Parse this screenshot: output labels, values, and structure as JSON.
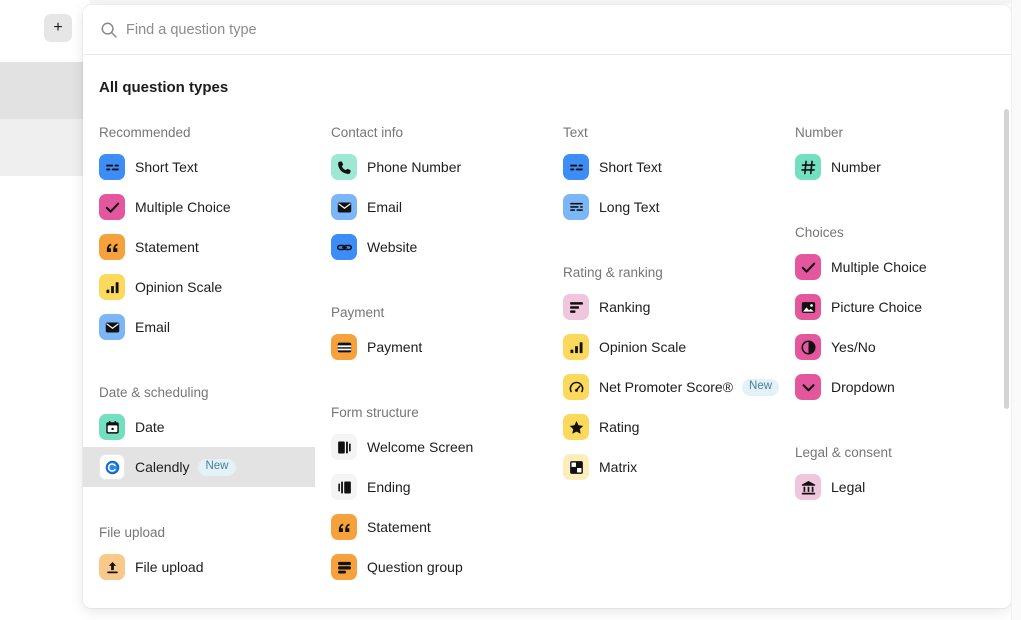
{
  "backdrop": {
    "add_button_label": "+"
  },
  "search": {
    "placeholder": "Find a question type",
    "value": "",
    "icon": "search-icon"
  },
  "panel": {
    "heading": "All question types"
  },
  "colors": {
    "blue": "#3c8df5",
    "blue_light": "#7bb6f7",
    "pink": "#e4579f",
    "pink_light": "#efc6dc",
    "orange": "#f6a23c",
    "yellow": "#fbd95c",
    "yellow_light": "#fbeeba",
    "teal": "#72e0c0",
    "white_tile": "#f4f4f4",
    "selected_row": "#e3e3e3",
    "badge_bg": "#e3f2f7",
    "badge_text": "#4a7f96"
  },
  "columns": [
    {
      "name": "column-1",
      "groups": [
        {
          "title": "Recommended",
          "items": [
            {
              "label": "Short Text",
              "icon": "short-text-icon",
              "tile": "blue"
            },
            {
              "label": "Multiple Choice",
              "icon": "check-icon",
              "tile": "pink"
            },
            {
              "label": "Statement",
              "icon": "quote-icon",
              "tile": "orange"
            },
            {
              "label": "Opinion Scale",
              "icon": "bar-chart-icon",
              "tile": "yellow"
            },
            {
              "label": "Email",
              "icon": "envelope-icon",
              "tile": "blue_light"
            }
          ]
        },
        {
          "title": "Date & scheduling",
          "spaced": true,
          "items": [
            {
              "label": "Date",
              "icon": "calendar-icon",
              "tile": "teal"
            },
            {
              "label": "Calendly",
              "icon": "calendly-icon",
              "tile": "white",
              "badge": "New",
              "selected": true
            }
          ]
        },
        {
          "title": "File upload",
          "spaced": true,
          "items": [
            {
              "label": "File upload",
              "icon": "upload-icon",
              "tile": "orange_light",
              "clipped": true
            }
          ]
        }
      ]
    },
    {
      "name": "column-2",
      "groups": [
        {
          "title": "Contact info",
          "items": [
            {
              "label": "Phone Number",
              "icon": "phone-icon",
              "tile": "teal_light"
            },
            {
              "label": "Email",
              "icon": "envelope-icon",
              "tile": "blue_light"
            },
            {
              "label": "Website",
              "icon": "link-icon",
              "tile": "blue"
            }
          ]
        },
        {
          "title": "Payment",
          "spaced": true,
          "items": [
            {
              "label": "Payment",
              "icon": "card-icon",
              "tile": "orange"
            }
          ]
        },
        {
          "title": "Form structure",
          "spaced": true,
          "items": [
            {
              "label": "Welcome Screen",
              "icon": "welcome-screen-icon",
              "tile": "white_tile"
            },
            {
              "label": "Ending",
              "icon": "ending-icon",
              "tile": "white_tile"
            },
            {
              "label": "Statement",
              "icon": "quote-icon",
              "tile": "orange"
            },
            {
              "label": "Question group",
              "icon": "group-icon",
              "tile": "orange",
              "clipped": true
            }
          ]
        }
      ]
    },
    {
      "name": "column-3",
      "groups": [
        {
          "title": "Text",
          "items": [
            {
              "label": "Short Text",
              "icon": "short-text-icon",
              "tile": "blue"
            },
            {
              "label": "Long Text",
              "icon": "long-text-icon",
              "tile": "blue_light"
            }
          ]
        },
        {
          "title": "Rating & ranking",
          "spaced": true,
          "items": [
            {
              "label": "Ranking",
              "icon": "ranking-icon",
              "tile": "pink_light"
            },
            {
              "label": "Opinion Scale",
              "icon": "bar-chart-icon",
              "tile": "yellow"
            },
            {
              "label": "Net Promoter Score®",
              "icon": "gauge-icon",
              "tile": "yellow",
              "badge": "New"
            },
            {
              "label": "Rating",
              "icon": "star-icon",
              "tile": "yellow"
            },
            {
              "label": "Matrix",
              "icon": "matrix-icon",
              "tile": "yellow_light"
            }
          ]
        }
      ]
    },
    {
      "name": "column-4",
      "groups": [
        {
          "title": "Number",
          "items": [
            {
              "label": "Number",
              "icon": "hash-icon",
              "tile": "teal"
            }
          ]
        },
        {
          "title": "Choices",
          "spaced": true,
          "items": [
            {
              "label": "Multiple Choice",
              "icon": "check-icon",
              "tile": "pink"
            },
            {
              "label": "Picture Choice",
              "icon": "picture-icon",
              "tile": "pink"
            },
            {
              "label": "Yes/No",
              "icon": "half-circle-icon",
              "tile": "pink"
            },
            {
              "label": "Dropdown",
              "icon": "chevron-down-icon",
              "tile": "pink"
            }
          ]
        },
        {
          "title": "Legal & consent",
          "spaced": true,
          "items": [
            {
              "label": "Legal",
              "icon": "bank-icon",
              "tile": "pink_light"
            }
          ]
        }
      ]
    }
  ]
}
